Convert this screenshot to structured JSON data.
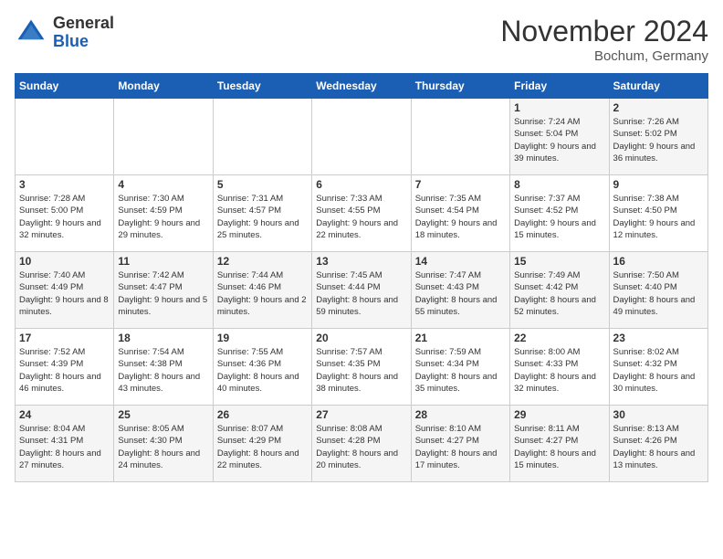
{
  "header": {
    "logo_general": "General",
    "logo_blue": "Blue",
    "month_title": "November 2024",
    "location": "Bochum, Germany"
  },
  "weekdays": [
    "Sunday",
    "Monday",
    "Tuesday",
    "Wednesday",
    "Thursday",
    "Friday",
    "Saturday"
  ],
  "weeks": [
    [
      {
        "day": "",
        "info": ""
      },
      {
        "day": "",
        "info": ""
      },
      {
        "day": "",
        "info": ""
      },
      {
        "day": "",
        "info": ""
      },
      {
        "day": "",
        "info": ""
      },
      {
        "day": "1",
        "info": "Sunrise: 7:24 AM\nSunset: 5:04 PM\nDaylight: 9 hours and 39 minutes."
      },
      {
        "day": "2",
        "info": "Sunrise: 7:26 AM\nSunset: 5:02 PM\nDaylight: 9 hours and 36 minutes."
      }
    ],
    [
      {
        "day": "3",
        "info": "Sunrise: 7:28 AM\nSunset: 5:00 PM\nDaylight: 9 hours and 32 minutes."
      },
      {
        "day": "4",
        "info": "Sunrise: 7:30 AM\nSunset: 4:59 PM\nDaylight: 9 hours and 29 minutes."
      },
      {
        "day": "5",
        "info": "Sunrise: 7:31 AM\nSunset: 4:57 PM\nDaylight: 9 hours and 25 minutes."
      },
      {
        "day": "6",
        "info": "Sunrise: 7:33 AM\nSunset: 4:55 PM\nDaylight: 9 hours and 22 minutes."
      },
      {
        "day": "7",
        "info": "Sunrise: 7:35 AM\nSunset: 4:54 PM\nDaylight: 9 hours and 18 minutes."
      },
      {
        "day": "8",
        "info": "Sunrise: 7:37 AM\nSunset: 4:52 PM\nDaylight: 9 hours and 15 minutes."
      },
      {
        "day": "9",
        "info": "Sunrise: 7:38 AM\nSunset: 4:50 PM\nDaylight: 9 hours and 12 minutes."
      }
    ],
    [
      {
        "day": "10",
        "info": "Sunrise: 7:40 AM\nSunset: 4:49 PM\nDaylight: 9 hours and 8 minutes."
      },
      {
        "day": "11",
        "info": "Sunrise: 7:42 AM\nSunset: 4:47 PM\nDaylight: 9 hours and 5 minutes."
      },
      {
        "day": "12",
        "info": "Sunrise: 7:44 AM\nSunset: 4:46 PM\nDaylight: 9 hours and 2 minutes."
      },
      {
        "day": "13",
        "info": "Sunrise: 7:45 AM\nSunset: 4:44 PM\nDaylight: 8 hours and 59 minutes."
      },
      {
        "day": "14",
        "info": "Sunrise: 7:47 AM\nSunset: 4:43 PM\nDaylight: 8 hours and 55 minutes."
      },
      {
        "day": "15",
        "info": "Sunrise: 7:49 AM\nSunset: 4:42 PM\nDaylight: 8 hours and 52 minutes."
      },
      {
        "day": "16",
        "info": "Sunrise: 7:50 AM\nSunset: 4:40 PM\nDaylight: 8 hours and 49 minutes."
      }
    ],
    [
      {
        "day": "17",
        "info": "Sunrise: 7:52 AM\nSunset: 4:39 PM\nDaylight: 8 hours and 46 minutes."
      },
      {
        "day": "18",
        "info": "Sunrise: 7:54 AM\nSunset: 4:38 PM\nDaylight: 8 hours and 43 minutes."
      },
      {
        "day": "19",
        "info": "Sunrise: 7:55 AM\nSunset: 4:36 PM\nDaylight: 8 hours and 40 minutes."
      },
      {
        "day": "20",
        "info": "Sunrise: 7:57 AM\nSunset: 4:35 PM\nDaylight: 8 hours and 38 minutes."
      },
      {
        "day": "21",
        "info": "Sunrise: 7:59 AM\nSunset: 4:34 PM\nDaylight: 8 hours and 35 minutes."
      },
      {
        "day": "22",
        "info": "Sunrise: 8:00 AM\nSunset: 4:33 PM\nDaylight: 8 hours and 32 minutes."
      },
      {
        "day": "23",
        "info": "Sunrise: 8:02 AM\nSunset: 4:32 PM\nDaylight: 8 hours and 30 minutes."
      }
    ],
    [
      {
        "day": "24",
        "info": "Sunrise: 8:04 AM\nSunset: 4:31 PM\nDaylight: 8 hours and 27 minutes."
      },
      {
        "day": "25",
        "info": "Sunrise: 8:05 AM\nSunset: 4:30 PM\nDaylight: 8 hours and 24 minutes."
      },
      {
        "day": "26",
        "info": "Sunrise: 8:07 AM\nSunset: 4:29 PM\nDaylight: 8 hours and 22 minutes."
      },
      {
        "day": "27",
        "info": "Sunrise: 8:08 AM\nSunset: 4:28 PM\nDaylight: 8 hours and 20 minutes."
      },
      {
        "day": "28",
        "info": "Sunrise: 8:10 AM\nSunset: 4:27 PM\nDaylight: 8 hours and 17 minutes."
      },
      {
        "day": "29",
        "info": "Sunrise: 8:11 AM\nSunset: 4:27 PM\nDaylight: 8 hours and 15 minutes."
      },
      {
        "day": "30",
        "info": "Sunrise: 8:13 AM\nSunset: 4:26 PM\nDaylight: 8 hours and 13 minutes."
      }
    ]
  ]
}
